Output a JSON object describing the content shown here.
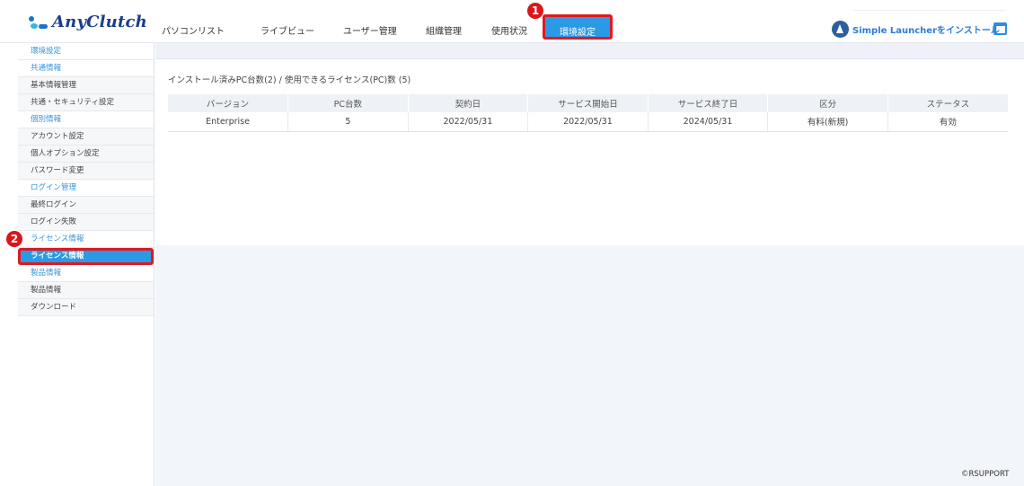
{
  "header": {
    "logo_text": "AnyClutch",
    "nav": [
      {
        "label": "パソコンリスト",
        "active": false
      },
      {
        "label": "ライブビュー",
        "active": false
      },
      {
        "label": "ユーザー管理",
        "active": false
      },
      {
        "label": "組織管理",
        "active": false
      },
      {
        "label": "使用状況",
        "active": false
      },
      {
        "label": "環境設定",
        "active": true
      }
    ],
    "launcher_label": "Simple Launcherをインストール"
  },
  "annotations": {
    "marker_1": "1",
    "marker_2": "2"
  },
  "sidebar": {
    "rows": [
      {
        "label": "環境設定",
        "kind": "category"
      },
      {
        "label": "共通情報",
        "kind": "category"
      },
      {
        "label": "基本情報管理",
        "kind": "item"
      },
      {
        "label": "共通・セキュリティ設定",
        "kind": "item"
      },
      {
        "label": "個別情報",
        "kind": "category"
      },
      {
        "label": "アカウント設定",
        "kind": "item"
      },
      {
        "label": "個人オプション設定",
        "kind": "item"
      },
      {
        "label": "パスワード変更",
        "kind": "item"
      },
      {
        "label": "ログイン管理",
        "kind": "category"
      },
      {
        "label": "最終ログイン",
        "kind": "item"
      },
      {
        "label": "ログイン失敗",
        "kind": "item"
      },
      {
        "label": "ライセンス情報",
        "kind": "category"
      },
      {
        "label": "ライセンス情報",
        "kind": "item",
        "active": true
      },
      {
        "label": "製品情報",
        "kind": "category"
      },
      {
        "label": "製品情報",
        "kind": "item"
      },
      {
        "label": "ダウンロード",
        "kind": "item"
      }
    ]
  },
  "main": {
    "summary": "インストール済みPC台数(2) / 使用できるライセンス(PC)数 (5)",
    "table": {
      "headers": [
        "バージョン",
        "PC台数",
        "契約日",
        "サービス開始日",
        "サービス終了日",
        "区分",
        "ステータス"
      ],
      "rows": [
        [
          "Enterprise",
          "5",
          "2022/05/31",
          "2022/05/31",
          "2024/05/31",
          "有料(新規)",
          "有効"
        ]
      ]
    }
  },
  "footer": {
    "copyright": "©RSUPPORT"
  },
  "colors": {
    "accent": "#2a9ae6",
    "highlight_border": "#e0191f",
    "category_text": "#3a93d9",
    "logo_text": "#1b3f86"
  },
  "icons": {
    "logo": "anyclutch-logo-mark",
    "launcher": "simple-launcher-icon",
    "window": "window-icon"
  }
}
